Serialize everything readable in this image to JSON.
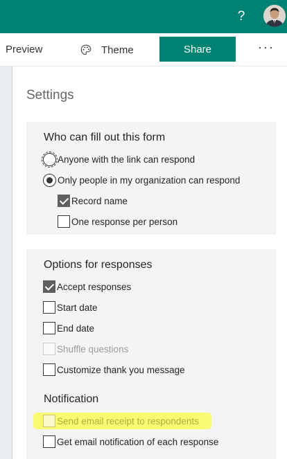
{
  "topbar": {
    "help_label": "?",
    "accent_color": "#008272"
  },
  "toolbar": {
    "preview_label": "Preview",
    "theme_label": "Theme",
    "share_label": "Share",
    "more_label": "···"
  },
  "settings": {
    "title": "Settings",
    "who": {
      "heading": "Who can fill out this form",
      "options": [
        {
          "label": "Anyone with the link can respond",
          "selected": false
        },
        {
          "label": "Only people in my organization can respond",
          "selected": true
        }
      ],
      "sub_options": [
        {
          "label": "Record name",
          "checked": true
        },
        {
          "label": "One response per person",
          "checked": false
        }
      ]
    },
    "responses": {
      "heading": "Options for responses",
      "options": [
        {
          "label": "Accept responses",
          "checked": true
        },
        {
          "label": "Start date",
          "checked": false
        },
        {
          "label": "End date",
          "checked": false
        },
        {
          "label": "Shuffle questions",
          "checked": false,
          "disabled": true
        },
        {
          "label": "Customize thank you message",
          "checked": false
        }
      ]
    },
    "notification": {
      "heading": "Notification",
      "options": [
        {
          "label": "Send email receipt to respondents",
          "checked": false,
          "highlighted": true
        },
        {
          "label": "Get email notification of each response",
          "checked": false
        }
      ]
    }
  }
}
